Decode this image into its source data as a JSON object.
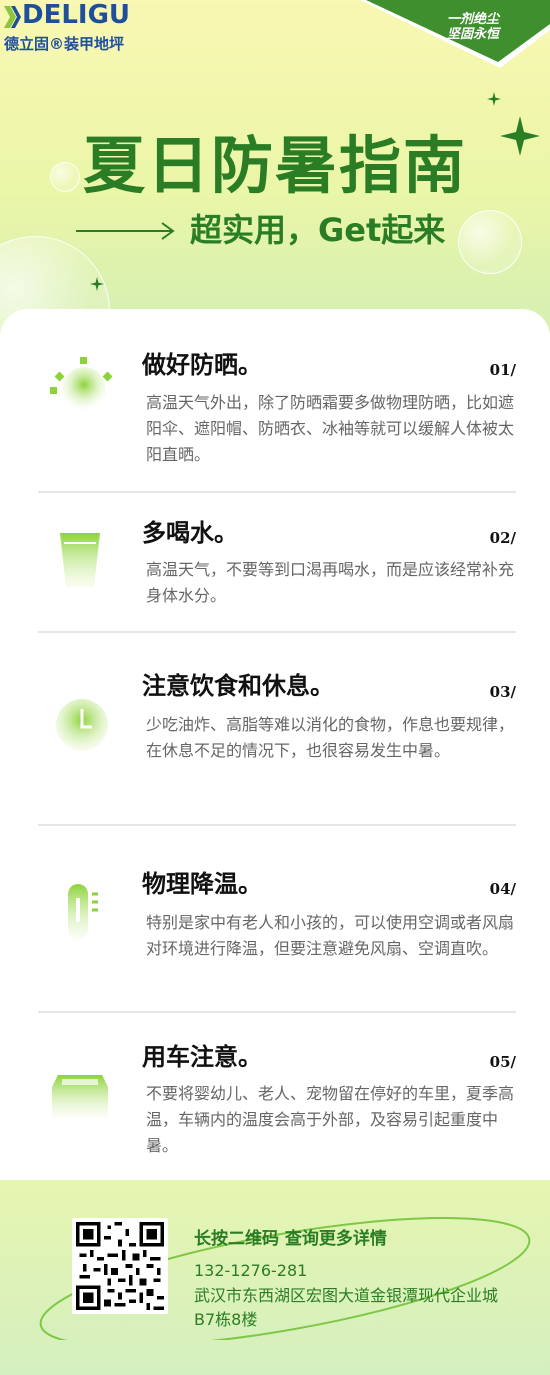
{
  "brand": {
    "name_en": "DELIGU",
    "name_cn": "德立固®装甲地坪",
    "slogan_line1": "一剂绝尘",
    "slogan_line2": "坚固永恒",
    "primary_color": "#1f4e9c"
  },
  "hero": {
    "title": "夏日防暑指南",
    "subtitle": "超实用，Get起来",
    "accent_color": "#2a7d24"
  },
  "tips": [
    {
      "number": "01/",
      "title": "做好防晒。",
      "icon": "sun-icon",
      "body": "高温天气外出，除了防晒霜要多做物理防晒，比如遮阳伞、遮阳帽、防晒衣、冰袖等就可以缓解人体被太阳直晒。"
    },
    {
      "number": "02/",
      "title": "多喝水。",
      "icon": "cup-icon",
      "body": "高温天气，不要等到口渴再喝水，而是应该经常补充身体水分。"
    },
    {
      "number": "03/",
      "title": "注意饮食和休息。",
      "icon": "clock-icon",
      "body": "少吃油炸、高脂等难以消化的食物，作息也要规律，在休息不足的情况下，也很容易发生中暑。"
    },
    {
      "number": "04/",
      "title": "物理降温。",
      "icon": "thermometer-icon",
      "body": "特别是家中有老人和小孩的，可以使用空调或者风扇对环境进行降温，但要注意避免风扇、空调直吹。"
    },
    {
      "number": "05/",
      "title": "用车注意。",
      "icon": "car-icon",
      "body": "不要将婴幼儿、老人、宠物留在停好的车里，夏季高温，车辆内的温度会高于外部，及容易引起重度中暑。"
    }
  ],
  "footer": {
    "qr_hint": "长按二维码 查询更多详情",
    "phone": "132-1276-281",
    "address": "武汉市东西湖区宏图大道金银潭现代企业城B7栋8楼"
  }
}
